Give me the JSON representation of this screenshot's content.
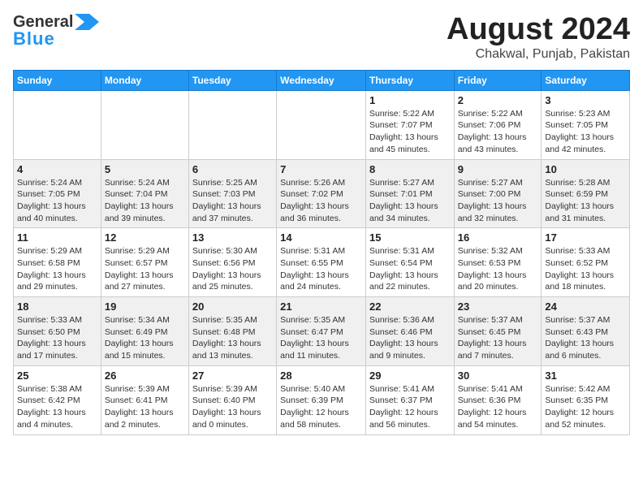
{
  "header": {
    "logo_line1": "General",
    "logo_line2": "Blue",
    "main_title": "August 2024",
    "sub_title": "Chakwal, Punjab, Pakistan"
  },
  "days_of_week": [
    "Sunday",
    "Monday",
    "Tuesday",
    "Wednesday",
    "Thursday",
    "Friday",
    "Saturday"
  ],
  "weeks": [
    [
      {
        "day": "",
        "info": ""
      },
      {
        "day": "",
        "info": ""
      },
      {
        "day": "",
        "info": ""
      },
      {
        "day": "",
        "info": ""
      },
      {
        "day": "1",
        "info": "Sunrise: 5:22 AM\nSunset: 7:07 PM\nDaylight: 13 hours\nand 45 minutes."
      },
      {
        "day": "2",
        "info": "Sunrise: 5:22 AM\nSunset: 7:06 PM\nDaylight: 13 hours\nand 43 minutes."
      },
      {
        "day": "3",
        "info": "Sunrise: 5:23 AM\nSunset: 7:05 PM\nDaylight: 13 hours\nand 42 minutes."
      }
    ],
    [
      {
        "day": "4",
        "info": "Sunrise: 5:24 AM\nSunset: 7:05 PM\nDaylight: 13 hours\nand 40 minutes."
      },
      {
        "day": "5",
        "info": "Sunrise: 5:24 AM\nSunset: 7:04 PM\nDaylight: 13 hours\nand 39 minutes."
      },
      {
        "day": "6",
        "info": "Sunrise: 5:25 AM\nSunset: 7:03 PM\nDaylight: 13 hours\nand 37 minutes."
      },
      {
        "day": "7",
        "info": "Sunrise: 5:26 AM\nSunset: 7:02 PM\nDaylight: 13 hours\nand 36 minutes."
      },
      {
        "day": "8",
        "info": "Sunrise: 5:27 AM\nSunset: 7:01 PM\nDaylight: 13 hours\nand 34 minutes."
      },
      {
        "day": "9",
        "info": "Sunrise: 5:27 AM\nSunset: 7:00 PM\nDaylight: 13 hours\nand 32 minutes."
      },
      {
        "day": "10",
        "info": "Sunrise: 5:28 AM\nSunset: 6:59 PM\nDaylight: 13 hours\nand 31 minutes."
      }
    ],
    [
      {
        "day": "11",
        "info": "Sunrise: 5:29 AM\nSunset: 6:58 PM\nDaylight: 13 hours\nand 29 minutes."
      },
      {
        "day": "12",
        "info": "Sunrise: 5:29 AM\nSunset: 6:57 PM\nDaylight: 13 hours\nand 27 minutes."
      },
      {
        "day": "13",
        "info": "Sunrise: 5:30 AM\nSunset: 6:56 PM\nDaylight: 13 hours\nand 25 minutes."
      },
      {
        "day": "14",
        "info": "Sunrise: 5:31 AM\nSunset: 6:55 PM\nDaylight: 13 hours\nand 24 minutes."
      },
      {
        "day": "15",
        "info": "Sunrise: 5:31 AM\nSunset: 6:54 PM\nDaylight: 13 hours\nand 22 minutes."
      },
      {
        "day": "16",
        "info": "Sunrise: 5:32 AM\nSunset: 6:53 PM\nDaylight: 13 hours\nand 20 minutes."
      },
      {
        "day": "17",
        "info": "Sunrise: 5:33 AM\nSunset: 6:52 PM\nDaylight: 13 hours\nand 18 minutes."
      }
    ],
    [
      {
        "day": "18",
        "info": "Sunrise: 5:33 AM\nSunset: 6:50 PM\nDaylight: 13 hours\nand 17 minutes."
      },
      {
        "day": "19",
        "info": "Sunrise: 5:34 AM\nSunset: 6:49 PM\nDaylight: 13 hours\nand 15 minutes."
      },
      {
        "day": "20",
        "info": "Sunrise: 5:35 AM\nSunset: 6:48 PM\nDaylight: 13 hours\nand 13 minutes."
      },
      {
        "day": "21",
        "info": "Sunrise: 5:35 AM\nSunset: 6:47 PM\nDaylight: 13 hours\nand 11 minutes."
      },
      {
        "day": "22",
        "info": "Sunrise: 5:36 AM\nSunset: 6:46 PM\nDaylight: 13 hours\nand 9 minutes."
      },
      {
        "day": "23",
        "info": "Sunrise: 5:37 AM\nSunset: 6:45 PM\nDaylight: 13 hours\nand 7 minutes."
      },
      {
        "day": "24",
        "info": "Sunrise: 5:37 AM\nSunset: 6:43 PM\nDaylight: 13 hours\nand 6 minutes."
      }
    ],
    [
      {
        "day": "25",
        "info": "Sunrise: 5:38 AM\nSunset: 6:42 PM\nDaylight: 13 hours\nand 4 minutes."
      },
      {
        "day": "26",
        "info": "Sunrise: 5:39 AM\nSunset: 6:41 PM\nDaylight: 13 hours\nand 2 minutes."
      },
      {
        "day": "27",
        "info": "Sunrise: 5:39 AM\nSunset: 6:40 PM\nDaylight: 13 hours\nand 0 minutes."
      },
      {
        "day": "28",
        "info": "Sunrise: 5:40 AM\nSunset: 6:39 PM\nDaylight: 12 hours\nand 58 minutes."
      },
      {
        "day": "29",
        "info": "Sunrise: 5:41 AM\nSunset: 6:37 PM\nDaylight: 12 hours\nand 56 minutes."
      },
      {
        "day": "30",
        "info": "Sunrise: 5:41 AM\nSunset: 6:36 PM\nDaylight: 12 hours\nand 54 minutes."
      },
      {
        "day": "31",
        "info": "Sunrise: 5:42 AM\nSunset: 6:35 PM\nDaylight: 12 hours\nand 52 minutes."
      }
    ]
  ]
}
